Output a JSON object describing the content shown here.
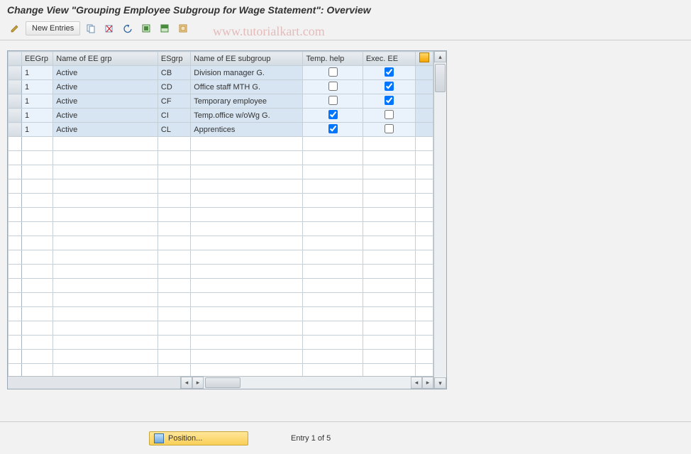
{
  "title": "Change View \"Grouping Employee Subgroup for Wage Statement\": Overview",
  "watermark": "www.tutorialkart.com",
  "toolbar": {
    "new_entries": "New Entries"
  },
  "table": {
    "headers": {
      "eegrp": "EEGrp",
      "eename": "Name of EE grp",
      "esgrp": "ESgrp",
      "esname": "Name of EE subgroup",
      "temp": "Temp. help",
      "exec": "Exec. EE"
    },
    "rows": [
      {
        "eegrp": "1",
        "eename": "Active",
        "esgrp": "CB",
        "esname": "Division manager  G.",
        "temp": false,
        "exec": true
      },
      {
        "eegrp": "1",
        "eename": "Active",
        "esgrp": "CD",
        "esname": "Office staff MTH  G.",
        "temp": false,
        "exec": true
      },
      {
        "eegrp": "1",
        "eename": "Active",
        "esgrp": "CF",
        "esname": "Temporary employee",
        "temp": false,
        "exec": true
      },
      {
        "eegrp": "1",
        "eename": "Active",
        "esgrp": "CI",
        "esname": "Temp.office w/oWg G.",
        "temp": true,
        "exec": false
      },
      {
        "eegrp": "1",
        "eename": "Active",
        "esgrp": "CL",
        "esname": "Apprentices",
        "temp": true,
        "exec": false
      }
    ],
    "empty_rows": 17
  },
  "footer": {
    "position_label": "Position...",
    "entry_text": "Entry 1 of 5"
  }
}
